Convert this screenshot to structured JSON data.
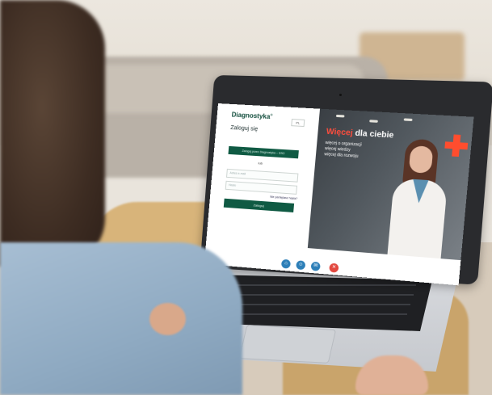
{
  "screen": {
    "login": {
      "brand": "Diagnostyka",
      "brand_mark": "®",
      "language": "PL",
      "title": "Zaloguj się",
      "primary_button": "Zaloguj przez Diagnostyka – SSO",
      "separator": "lub",
      "email_placeholder": "Adres e-mail",
      "password_placeholder": "Hasło",
      "forgot_link": "Nie pamiętasz hasła?",
      "submit_button": "Zaloguj"
    },
    "promo": {
      "title_highlight": "Więcej",
      "title_rest": " dla ciebie",
      "line1": "więcej o organizacji",
      "line2": "więcej wiedzy",
      "line3": "więcej dla rozwoju",
      "accent_color": "#ff4d3d"
    },
    "dock_icons": [
      {
        "name": "home-icon",
        "color": "#2d7fb8"
      },
      {
        "name": "people-icon",
        "color": "#2d7fb8"
      },
      {
        "name": "chat-icon",
        "color": "#2d7fb8"
      },
      {
        "name": "close-icon",
        "color": "#e2483f"
      }
    ]
  }
}
